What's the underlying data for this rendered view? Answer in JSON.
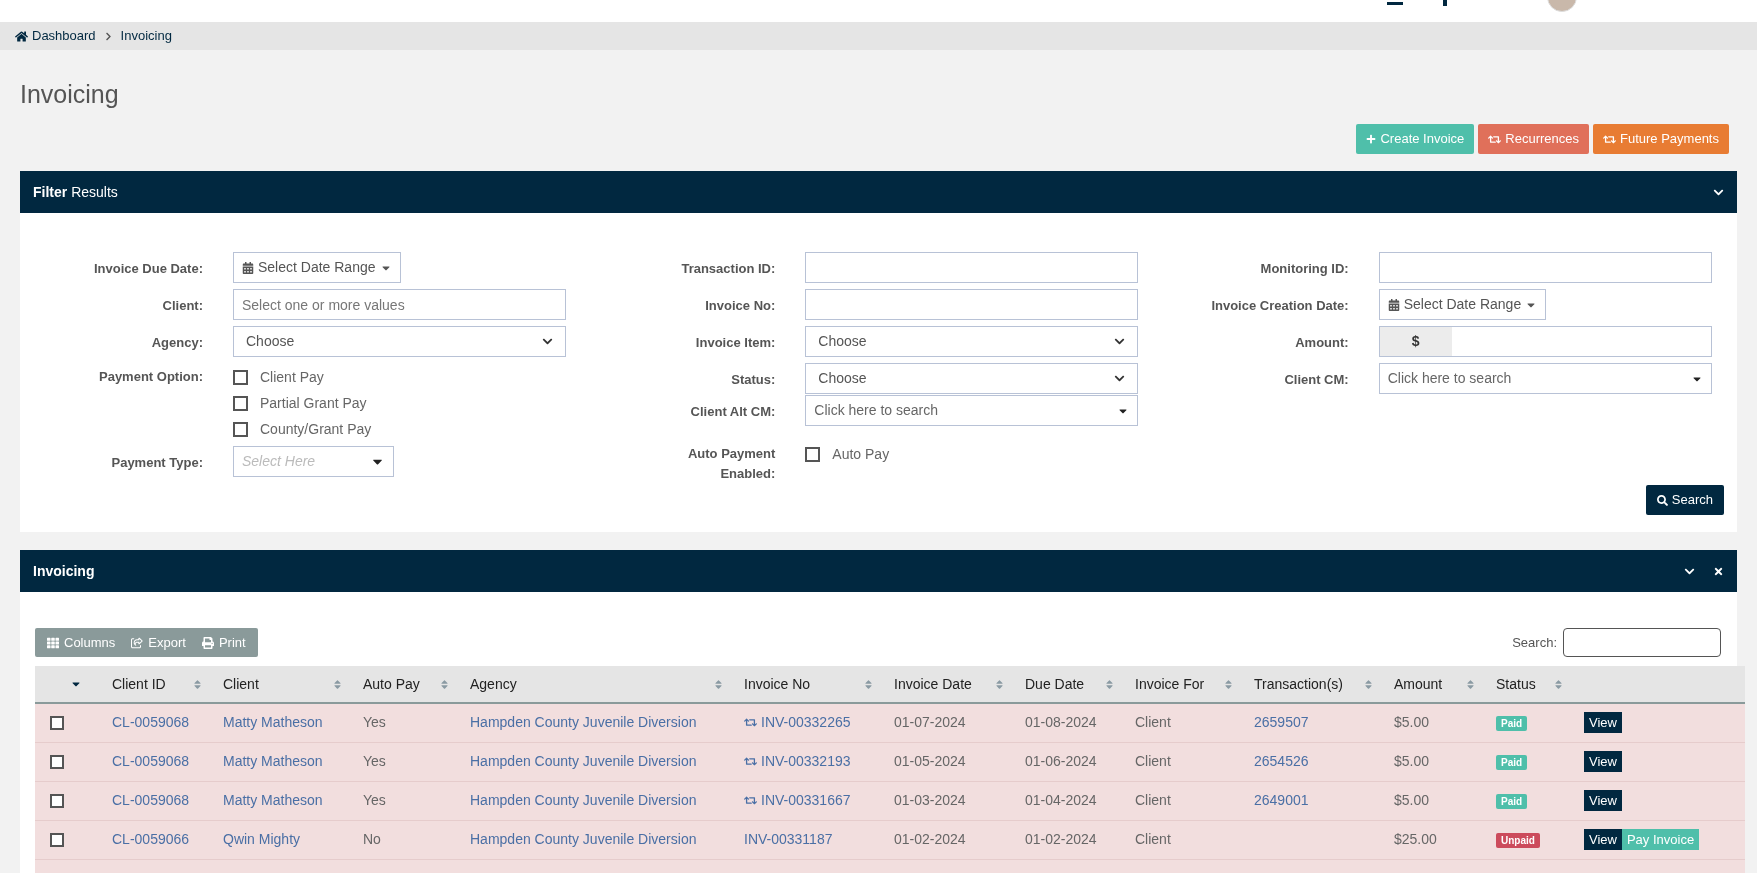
{
  "breadcrumb": [
    {
      "label": "Dashboard"
    },
    {
      "label": "Invoicing"
    }
  ],
  "page_title": "Invoicing",
  "header_buttons": [
    {
      "label": "Create Invoice",
      "kind": "create",
      "color": "#4fbfaa"
    },
    {
      "label": "Recurrences",
      "kind": "repeat",
      "color": "#e0705a"
    },
    {
      "label": "Future Payments",
      "kind": "repeat",
      "color": "#e87c33"
    }
  ],
  "filter_panel": {
    "title_bold": "Filter",
    "title_rest": "Results",
    "columns": [
      [
        {
          "label": "Invoice Due Date:",
          "kind": "date_range",
          "value": "Select Date Range"
        },
        {
          "label": "Client:",
          "kind": "text",
          "placeholder": "Select one or more values"
        },
        {
          "label": "Agency:",
          "kind": "select",
          "value": "Choose"
        },
        {
          "label": "Payment Option:",
          "kind": "checkboxes",
          "options": [
            {
              "label": "Client Pay",
              "checked": false
            },
            {
              "label": "Partial Grant Pay",
              "checked": false
            },
            {
              "label": "County/Grant Pay",
              "checked": false
            }
          ]
        },
        {
          "label": "Payment Type:",
          "kind": "combo",
          "placeholder": "Select Here"
        }
      ],
      [
        {
          "label": "Transaction ID:",
          "kind": "text"
        },
        {
          "label": "Invoice No:",
          "kind": "text"
        },
        {
          "label": "Invoice Item:",
          "kind": "select",
          "value": "Choose"
        },
        {
          "label": "Status:",
          "kind": "select",
          "value": "Choose"
        },
        {
          "label": "Client Alt CM:",
          "kind": "search_select",
          "placeholder": "Click here to search"
        },
        {
          "label": "Auto Payment Enabled:",
          "kind": "checkboxes",
          "options": [
            {
              "label": "Auto Pay",
              "checked": false
            }
          ]
        }
      ],
      [
        {
          "label": "Monitoring ID:",
          "kind": "text"
        },
        {
          "label": "Invoice Creation Date:",
          "kind": "date_range",
          "value": "Select Date Range"
        },
        {
          "label": "Amount:",
          "kind": "currency",
          "prefix": "$"
        },
        {
          "label": "Client CM:",
          "kind": "search_select",
          "placeholder": "Click here to search"
        }
      ]
    ],
    "search_button": "Search"
  },
  "invoicing_panel": {
    "title": "Invoicing",
    "toolbar": [
      {
        "label": "Columns",
        "kind": "columns"
      },
      {
        "label": "Export",
        "kind": "export"
      },
      {
        "label": "Print",
        "kind": "print"
      }
    ],
    "search_label": "Search:",
    "columns": [
      {
        "kind": "select"
      },
      {
        "label": "Client ID",
        "sortable": true
      },
      {
        "label": "Client",
        "sortable": true
      },
      {
        "label": "Auto Pay",
        "sortable": true
      },
      {
        "label": "Agency",
        "sortable": true
      },
      {
        "label": "Invoice No",
        "sortable": true
      },
      {
        "label": "Invoice Date",
        "sortable": true
      },
      {
        "label": "Due Date",
        "sortable": true
      },
      {
        "label": "Invoice For",
        "sortable": true
      },
      {
        "label": "Transaction(s)",
        "sortable": true
      },
      {
        "label": "Amount",
        "sortable": true
      },
      {
        "label": "Status",
        "sortable": true
      },
      {
        "kind": "actions"
      }
    ],
    "rows": [
      {
        "checked": false,
        "client_id": "CL-0059068",
        "client": "Matty Matheson",
        "auto_pay": "Yes",
        "agency": "Hampden County Juvenile Diversion",
        "invoice_no": "INV-00332265",
        "recurring": true,
        "invoice_date": "01-07-2024",
        "due_date": "01-08-2024",
        "invoice_for": "Client",
        "transaction": "2659507",
        "amount": "$5.00",
        "status": {
          "label": "Paid",
          "color": "#4fbfaa"
        },
        "actions": [
          {
            "label": "View",
            "kind": "view"
          }
        ]
      },
      {
        "checked": false,
        "client_id": "CL-0059068",
        "client": "Matty Matheson",
        "auto_pay": "Yes",
        "agency": "Hampden County Juvenile Diversion",
        "invoice_no": "INV-00332193",
        "recurring": true,
        "invoice_date": "01-05-2024",
        "due_date": "01-06-2024",
        "invoice_for": "Client",
        "transaction": "2654526",
        "amount": "$5.00",
        "status": {
          "label": "Paid",
          "color": "#4fbfaa"
        },
        "actions": [
          {
            "label": "View",
            "kind": "view"
          }
        ]
      },
      {
        "checked": false,
        "client_id": "CL-0059068",
        "client": "Matty Matheson",
        "auto_pay": "Yes",
        "agency": "Hampden County Juvenile Diversion",
        "invoice_no": "INV-00331667",
        "recurring": true,
        "invoice_date": "01-03-2024",
        "due_date": "01-04-2024",
        "invoice_for": "Client",
        "transaction": "2649001",
        "amount": "$5.00",
        "status": {
          "label": "Paid",
          "color": "#4fbfaa"
        },
        "actions": [
          {
            "label": "View",
            "kind": "view"
          }
        ]
      },
      {
        "checked": false,
        "client_id": "CL-0059066",
        "client": "Qwin Mighty",
        "auto_pay": "No",
        "agency": "Hampden County Juvenile Diversion",
        "invoice_no": "INV-00331187",
        "recurring": false,
        "invoice_date": "01-02-2024",
        "due_date": "01-02-2024",
        "invoice_for": "Client",
        "transaction": "",
        "amount": "$25.00",
        "status": {
          "label": "Unpaid",
          "color": "#cc4b5c"
        },
        "actions": [
          {
            "label": "View",
            "kind": "view"
          },
          {
            "label": "Pay Invoice",
            "kind": "pay"
          }
        ]
      }
    ]
  }
}
